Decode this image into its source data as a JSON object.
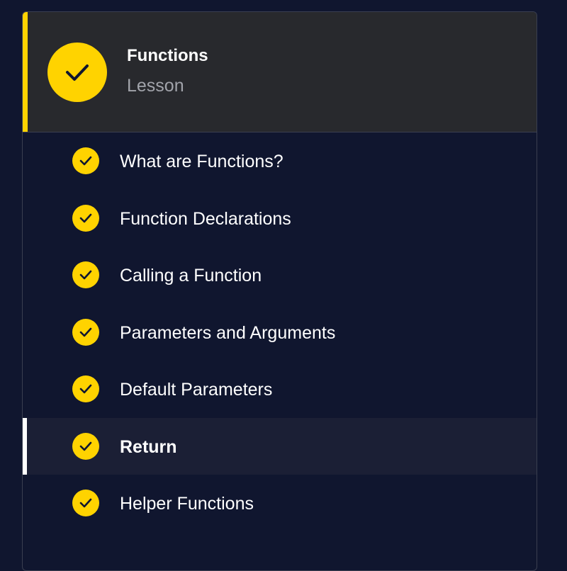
{
  "colors": {
    "background": "#10162f",
    "header_background": "#28292d",
    "accent": "#ffd300",
    "active_indicator": "#ffffff",
    "subtitle": "#a2a4ab"
  },
  "lesson": {
    "title": "Functions",
    "subtitle": "Lesson",
    "status_icon": "check-icon"
  },
  "items": [
    {
      "label": "What are Functions?",
      "completed": true,
      "active": false
    },
    {
      "label": "Function Declarations",
      "completed": true,
      "active": false
    },
    {
      "label": "Calling a Function",
      "completed": true,
      "active": false
    },
    {
      "label": "Parameters and Arguments",
      "completed": true,
      "active": false
    },
    {
      "label": "Default Parameters",
      "completed": true,
      "active": false
    },
    {
      "label": "Return",
      "completed": true,
      "active": true
    },
    {
      "label": "Helper Functions",
      "completed": true,
      "active": false
    }
  ]
}
